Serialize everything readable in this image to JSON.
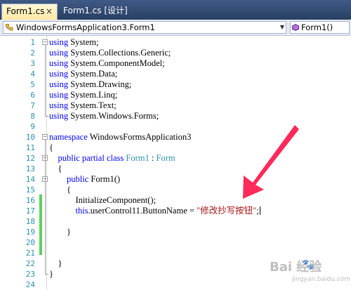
{
  "tabs": [
    {
      "label": "Form1.cs",
      "close": "×",
      "active": true
    },
    {
      "label": "Form1.cs [设计]",
      "active": false
    }
  ],
  "nav": {
    "class_combo": "WindowsFormsApplication3.Form1",
    "member_combo": "Form1()",
    "dropdown_glyph": "▼"
  },
  "editor": {
    "lines": [
      {
        "n": "1",
        "fold": "−",
        "tokens": [
          {
            "t": "using",
            "c": "kw"
          },
          {
            "t": " System;"
          }
        ]
      },
      {
        "n": "2",
        "tokens": [
          {
            "t": "using",
            "c": "kw"
          },
          {
            "t": " System.Collections.Generic;"
          }
        ]
      },
      {
        "n": "3",
        "tokens": [
          {
            "t": "using",
            "c": "kw"
          },
          {
            "t": " System.ComponentModel;"
          }
        ]
      },
      {
        "n": "4",
        "tokens": [
          {
            "t": "using",
            "c": "kw"
          },
          {
            "t": " System.Data;"
          }
        ]
      },
      {
        "n": "5",
        "tokens": [
          {
            "t": "using",
            "c": "kw"
          },
          {
            "t": " System.Drawing;"
          }
        ]
      },
      {
        "n": "6",
        "tokens": [
          {
            "t": "using",
            "c": "kw"
          },
          {
            "t": " System.Linq;"
          }
        ]
      },
      {
        "n": "7",
        "tokens": [
          {
            "t": "using",
            "c": "kw"
          },
          {
            "t": " System.Text;"
          }
        ]
      },
      {
        "n": "8",
        "tokens": [
          {
            "t": "using",
            "c": "kw"
          },
          {
            "t": " System.Windows.Forms;"
          }
        ]
      },
      {
        "n": "9",
        "tokens": []
      },
      {
        "n": "10",
        "fold": "−",
        "tokens": [
          {
            "t": "namespace",
            "c": "kw"
          },
          {
            "t": " WindowsFormsApplication3"
          }
        ]
      },
      {
        "n": "11",
        "tokens": [
          {
            "t": "{"
          }
        ]
      },
      {
        "n": "12",
        "fold": "−",
        "tokens": [
          {
            "t": "    "
          },
          {
            "t": "public",
            "c": "kw"
          },
          {
            "t": " "
          },
          {
            "t": "partial",
            "c": "kw"
          },
          {
            "t": " "
          },
          {
            "t": "class",
            "c": "kw"
          },
          {
            "t": " "
          },
          {
            "t": "Form1",
            "c": "ty"
          },
          {
            "t": " : "
          },
          {
            "t": "Form",
            "c": "ty"
          }
        ]
      },
      {
        "n": "13",
        "tokens": [
          {
            "t": "    {"
          }
        ]
      },
      {
        "n": "14",
        "fold": "−",
        "tokens": [
          {
            "t": "        "
          },
          {
            "t": "public",
            "c": "kw"
          },
          {
            "t": " Form1()"
          }
        ]
      },
      {
        "n": "15",
        "tokens": [
          {
            "t": "        {"
          }
        ]
      },
      {
        "n": "16",
        "tokens": [
          {
            "t": "            InitializeComponent();"
          }
        ]
      },
      {
        "n": "17",
        "caret": true,
        "tokens": [
          {
            "t": "            "
          },
          {
            "t": "this",
            "c": "kw"
          },
          {
            "t": ".userControl11.ButtonName = "
          },
          {
            "t": "\"修改抄写按钮\"",
            "c": "str"
          },
          {
            "t": ";"
          }
        ]
      },
      {
        "n": "18",
        "tokens": []
      },
      {
        "n": "19",
        "tokens": [
          {
            "t": "        }"
          }
        ]
      },
      {
        "n": "20",
        "tokens": []
      },
      {
        "n": "21",
        "tokens": []
      },
      {
        "n": "22",
        "tokens": [
          {
            "t": "    }"
          }
        ]
      },
      {
        "n": "23",
        "tokens": [
          {
            "t": "}"
          }
        ]
      },
      {
        "n": "24",
        "tokens": []
      }
    ]
  },
  "annotation": {
    "arrow_color": "#ff2a5a"
  },
  "watermark": {
    "main": "Bai  经验",
    "sub": "jingyan.baidu.com"
  },
  "colors": {
    "keyword": "#0000ff",
    "type": "#2b91af",
    "string": "#a31515",
    "line_number": "#2b91af",
    "change_bar": "#5ad05a"
  }
}
